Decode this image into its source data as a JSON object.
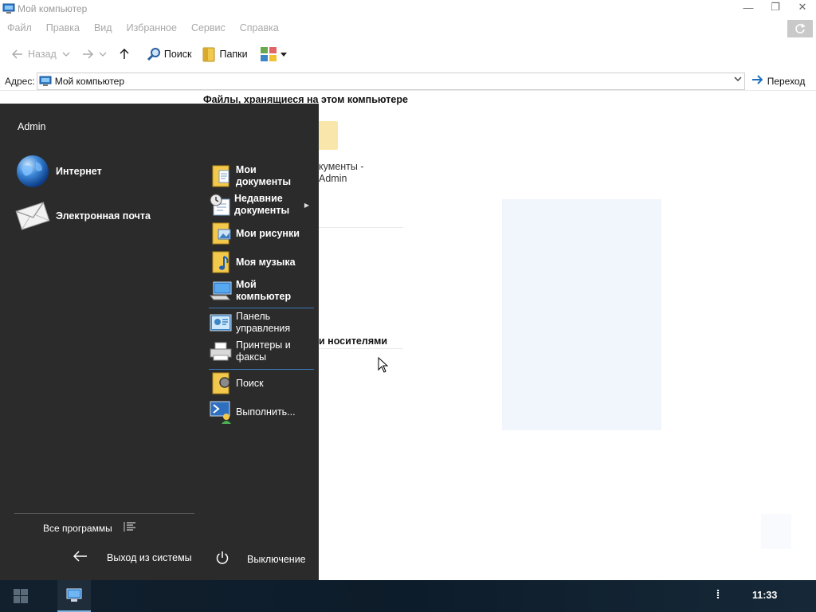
{
  "window": {
    "title": "Мой компьютер",
    "controls": {
      "minimize": "—",
      "restore": "❐",
      "close": "✕"
    },
    "menu": [
      "Файл",
      "Правка",
      "Вид",
      "Избранное",
      "Сервис",
      "Справка"
    ],
    "toolbar": {
      "back": "Назад",
      "search": "Поиск",
      "folders": "Папки"
    },
    "address": {
      "label": "Адрес:",
      "value": "Мой компьютер",
      "go": "Переход"
    },
    "content": {
      "section1": "Файлы, хранящиеся на этом компьютере",
      "folder_caption_1": "кументы -",
      "folder_caption_2": "Admin",
      "section2": "и носителями"
    }
  },
  "start_menu": {
    "user": "Admin",
    "pinned": [
      {
        "label": "Интернет",
        "icon": "globe-icon"
      },
      {
        "label": "Электронная почта",
        "icon": "mail-icon"
      }
    ],
    "right": [
      {
        "label": "Мои документы",
        "icon": "my-documents-icon",
        "bold": true
      },
      {
        "label": "Недавние документы",
        "icon": "recent-documents-icon",
        "bold": true,
        "submenu": true
      },
      {
        "label": "Мои рисунки",
        "icon": "my-pictures-icon",
        "bold": true
      },
      {
        "label": "Моя музыка",
        "icon": "my-music-icon",
        "bold": true
      },
      {
        "label": "Мой компьютер",
        "icon": "my-computer-icon",
        "bold": true
      },
      {
        "label": "Панель управления",
        "icon": "control-panel-icon",
        "bold": false
      },
      {
        "label": "Принтеры и факсы",
        "icon": "printers-icon",
        "bold": false
      },
      {
        "label": "Поиск",
        "icon": "search-icon",
        "bold": false
      },
      {
        "label": "Выполнить...",
        "icon": "run-icon",
        "bold": false
      }
    ],
    "all_programs": "Все программы",
    "logoff": "Выход из системы",
    "shutdown": "Выключение"
  },
  "taskbar": {
    "clock": "11:33",
    "tray_more": "⁞"
  },
  "colors": {
    "start_menu_bg": "#2b2b2b",
    "separator": "#3a78b6",
    "taskbar": "#12202e"
  }
}
